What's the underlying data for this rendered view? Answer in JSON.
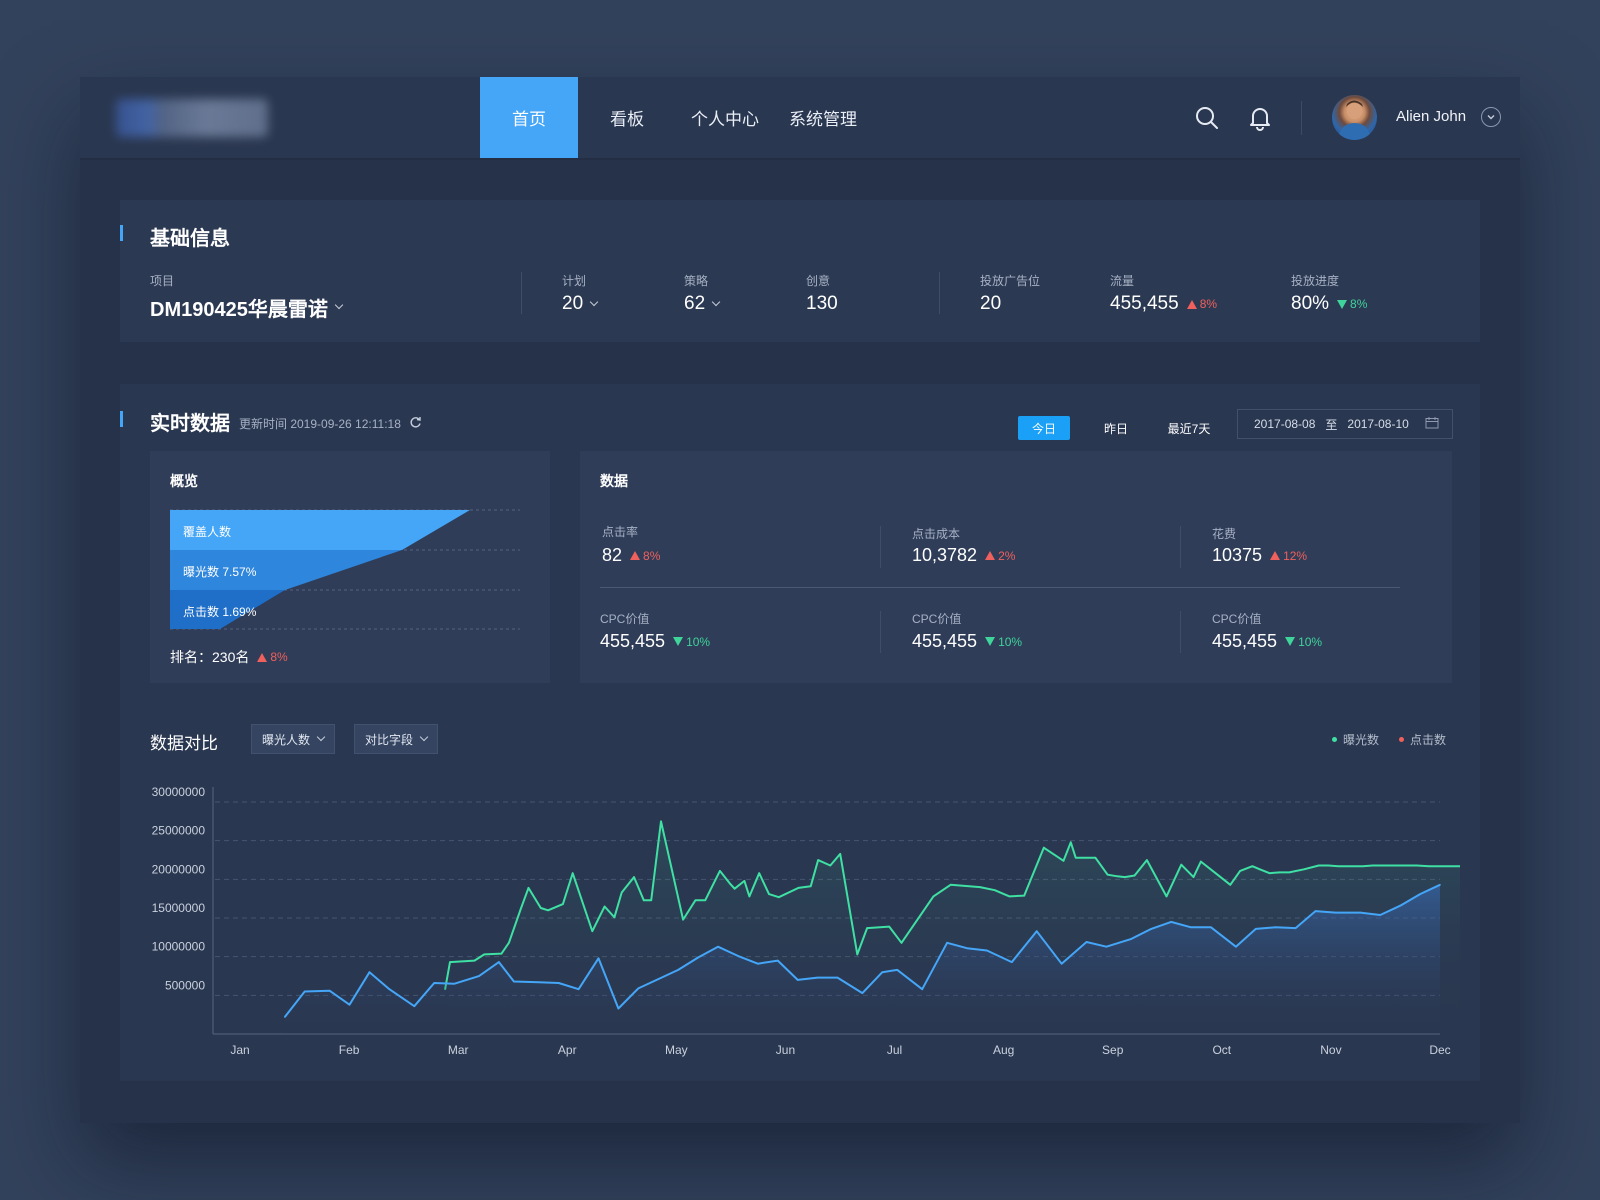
{
  "nav": {
    "items": [
      {
        "label": "首页",
        "active": true
      },
      {
        "label": "看板",
        "active": false
      },
      {
        "label": "个人中心",
        "active": false
      },
      {
        "label": "系统管理",
        "active": false
      }
    ]
  },
  "user": {
    "name": "Alien John"
  },
  "basic": {
    "title": "基础信息",
    "project_label": "项目",
    "project_value": "DM190425华晨雷诺",
    "plan_label": "计划",
    "plan_value": "20",
    "strategy_label": "策略",
    "strategy_value": "62",
    "creative_label": "创意",
    "creative_value": "130",
    "adslot_label": "投放广告位",
    "adslot_value": "20",
    "traffic_label": "流量",
    "traffic_value": "455,455",
    "traffic_change": "8%",
    "progress_label": "投放进度",
    "progress_value": "80%",
    "progress_change": "8%"
  },
  "realtime": {
    "title": "实时数据",
    "update_label": "更新时间 2019-09-26 12:11:18",
    "tabs": [
      "今日",
      "昨日",
      "最近7天"
    ],
    "active_tab": "今日",
    "date_from": "2017-08-08",
    "date_to_sep": "至",
    "date_to": "2017-08-10"
  },
  "overview": {
    "title": "概览",
    "funnel": [
      {
        "label": "覆盖人数",
        "color": "#45a6f8"
      },
      {
        "label": "曝光数 7.57%",
        "color": "#2f86dd"
      },
      {
        "label": "点击数 1.69%",
        "color": "#1f6ec7"
      }
    ],
    "rank_label": "排名：230名",
    "rank_change": "8%"
  },
  "metrics": {
    "title": "数据",
    "row1": [
      {
        "label": "点击率",
        "value": "82",
        "change": "8%",
        "dir": "up"
      },
      {
        "label": "点击成本",
        "value": "10,3782",
        "change": "2%",
        "dir": "up"
      },
      {
        "label": "花费",
        "value": "10375",
        "change": "12%",
        "dir": "up"
      }
    ],
    "row2": [
      {
        "label": "CPC价值",
        "value": "455,455",
        "change": "10%",
        "dir": "down"
      },
      {
        "label": "CPC价值",
        "value": "455,455",
        "change": "10%",
        "dir": "down"
      },
      {
        "label": "CPC价值",
        "value": "455,455",
        "change": "10%",
        "dir": "down"
      }
    ]
  },
  "compare": {
    "title": "数据对比",
    "select1": "曝光人数",
    "select2": "对比字段",
    "legend": [
      {
        "label": "曝光数",
        "color": "#3fe0a3"
      },
      {
        "label": "点击数",
        "color": "#f0605c"
      }
    ]
  },
  "chart_data": {
    "type": "line",
    "title": "",
    "xlabel": "",
    "ylabel": "",
    "x_ticks": [
      "Jan",
      "Feb",
      "Mar",
      "Apr",
      "May",
      "Jun",
      "Jul",
      "Aug",
      "Sep",
      "Oct",
      "Nov",
      "Dec"
    ],
    "y_ticks": [
      "500000",
      "10000000",
      "15000000",
      "20000000",
      "25000000",
      "30000000"
    ],
    "ylim": [
      0,
      30000000
    ],
    "grid": true,
    "colors": {
      "green": "#3fe0a3",
      "blue": "#45a6f8"
    },
    "series": [
      {
        "x": [
          2.4,
          2.5,
          3.0,
          3.2,
          3.55,
          3.7,
          3.95,
          4.1,
          4.35,
          4.5,
          4.8,
          5.0,
          5.4,
          5.65,
          5.85,
          6.0,
          6.25,
          6.45,
          6.6,
          6.8,
          7.25,
          7.5,
          7.7,
          8.0,
          8.2,
          8.3,
          8.5,
          8.6,
          8.8,
          9.0,
          9.2,
          9.6,
          9.85,
          10.0,
          10.25,
          10.45,
          10.8,
          11.0,
          11.45,
          11.7,
          12.35,
          12.7,
          13.3,
          13.6,
          13.9,
          14.2,
          14.6,
          15.0,
          15.15,
          15.25,
          15.65,
          15.9,
          16.1,
          16.25,
          16.45,
          16.7,
          17.1,
          17.4,
          17.65,
          17.8,
          18.1,
          18.4,
          18.6,
          18.85,
          19.0,
          19.2,
          19.4,
          19.6,
          19.9,
          20.2,
          20.4,
          20.6,
          20.8,
          21.1,
          21.3,
          21.6,
          21.9,
          22.2,
          22.45,
          22.75,
          23.0,
          23.3,
          23.45
        ],
        "values": [
          4500000,
          8000000,
          8200000,
          9000000,
          9100000,
          10500000,
          15000000,
          17600000,
          15000000,
          14700000,
          15500000,
          19500000,
          12000000,
          15200000,
          13800000,
          17000000,
          19000000,
          16000000,
          16000000,
          26200000,
          13500000,
          16000000,
          16000000,
          19800000,
          18200000,
          17500000,
          18500000,
          16500000,
          19500000,
          16800000,
          16400000,
          17600000,
          17800000,
          21200000,
          20500000,
          22000000,
          9000000,
          12400000,
          12600000,
          10500000,
          16500000,
          18000000,
          17700000,
          17300000,
          16500000,
          16600000,
          22800000,
          21100000,
          23500000,
          21500000,
          21500000,
          19300000,
          19100000,
          19000000,
          19200000,
          21200000,
          16500000,
          20600000,
          19000000,
          21000000,
          19500000,
          18000000,
          19800000,
          20400000,
          20000000,
          19500000,
          19600000,
          19600000,
          20000000,
          20500000,
          20500000,
          20400000,
          20400000,
          20400000,
          20500000,
          20500000,
          20500000,
          20500000,
          20400000,
          20400000,
          20400000,
          20400000,
          20400000
        ]
      },
      {
        "x": [
          0.45,
          0.65,
          0.9,
          1.1,
          1.3,
          1.5,
          1.75,
          1.95,
          2.15,
          2.4,
          2.6,
          2.75,
          3.0,
          3.2,
          3.4,
          3.6,
          3.8,
          4.0,
          4.2,
          4.4,
          4.6,
          4.8,
          5.0,
          5.2,
          5.4,
          5.6,
          5.8,
          6.0,
          6.25,
          6.45,
          6.6,
          6.85,
          7.1,
          7.3,
          7.5,
          7.75,
          8.0,
          8.25,
          8.5,
          8.7,
          8.95,
          9.15,
          9.35,
          9.55,
          9.75,
          10.0,
          10.2,
          10.4,
          10.6,
          10.8,
          11.0,
          11.25,
          11.45,
          11.65,
          11.85,
          12.05
        ],
        "values": [
          900000,
          4200000,
          4300000,
          2500000,
          6700000,
          4500000,
          2300000,
          5300000,
          5200000,
          6200000,
          8000000,
          5500000,
          5400000,
          5300000,
          4500000,
          8500000,
          2000000,
          4600000,
          5800000,
          7000000,
          8600000,
          10000000,
          8800000,
          7800000,
          8200000,
          5700000,
          6000000,
          6000000,
          4000000,
          6700000,
          7000000,
          4500000,
          10500000,
          9800000,
          9500000,
          8000000,
          12000000,
          7800000,
          10600000,
          10000000,
          11000000,
          12300000,
          13200000,
          12500000,
          12500000,
          10000000,
          12300000,
          12500000,
          12400000,
          14600000,
          14400000,
          14400000,
          14100000,
          15300000,
          16800000,
          18000000
        ]
      }
    ]
  }
}
